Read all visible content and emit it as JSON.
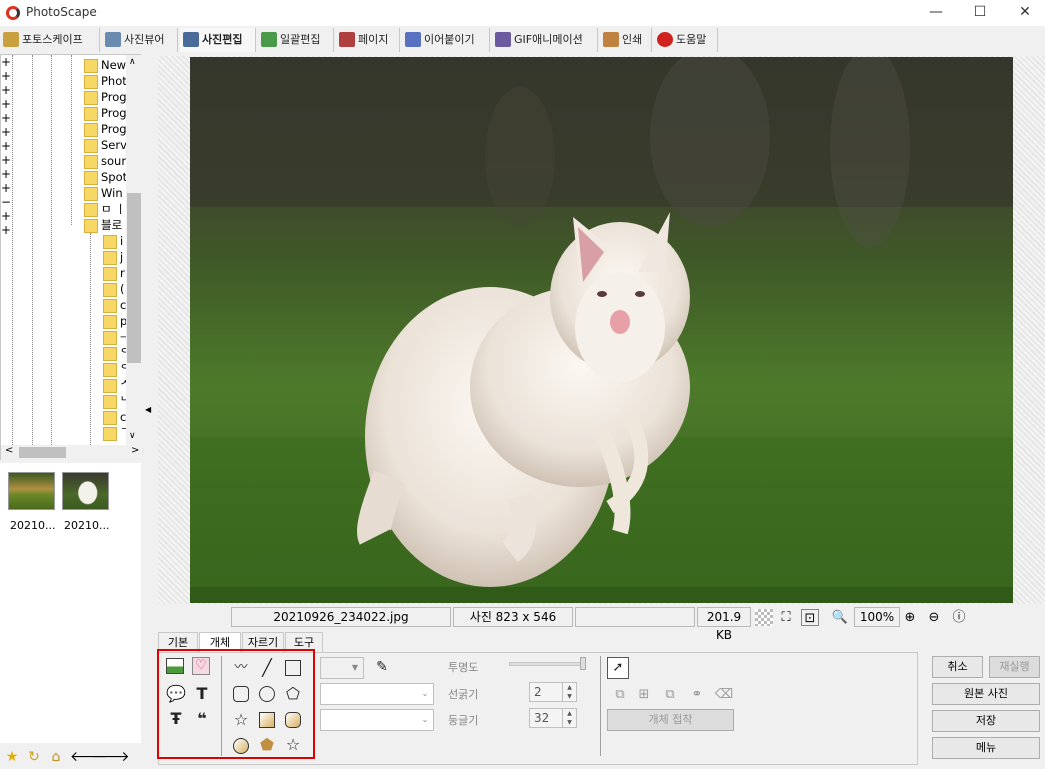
{
  "window": {
    "title": "PhotoScape",
    "minimize": "—",
    "maximize": "☐",
    "close": "✕"
  },
  "tabs": [
    {
      "label": "포토스케이프",
      "icon": "photoscape-books-icon",
      "color": "#c8a040"
    },
    {
      "label": "사진뷰어",
      "icon": "viewer-books-icon",
      "color": "#6a8ab0"
    },
    {
      "label": "사진편집",
      "icon": "editor-books-icon",
      "color": "#4a6a9a"
    },
    {
      "label": "일괄편집",
      "icon": "batch-books-icon",
      "color": "#4a9a4a"
    },
    {
      "label": "페이지",
      "icon": "page-books-icon",
      "color": "#b04040"
    },
    {
      "label": "이어붙이기",
      "icon": "combine-books-icon",
      "color": "#5a70c0"
    },
    {
      "label": "GIF애니메이션",
      "icon": "gif-books-icon",
      "color": "#6a5aa0"
    },
    {
      "label": "인쇄",
      "icon": "print-books-icon",
      "color": "#c08040"
    },
    {
      "label": "도움말",
      "icon": "help-icon",
      "color": "#d02020"
    }
  ],
  "tree": {
    "items": [
      "New",
      "Phot",
      "Prog",
      "Prog",
      "Prog",
      "Serv",
      "sour",
      "Spot",
      "Win",
      "ㅁ ㅣ",
      "블로",
      "i",
      "j",
      "r",
      "(",
      "c",
      "p",
      "ᅳ",
      "ᄋ",
      "ᄋ",
      "ᄉ",
      "ᄂ",
      "c",
      "ᄀ"
    ]
  },
  "thumbnails": [
    {
      "label": "20210...",
      "kind": "landscape"
    },
    {
      "label": "20210...",
      "kind": "wallaby"
    }
  ],
  "status": {
    "filename": "20210926_234022.jpg",
    "dimensions": "사진 823 x 546",
    "empty": "",
    "filesize": "201.9 KB",
    "zoom": "100%"
  },
  "subtabs": [
    "기본",
    "개체",
    "자르기",
    "도구"
  ],
  "active_subtab": "개체",
  "object_panel": {
    "opacity_label": "투명도",
    "line_width_label": "선굵기",
    "line_width_value": "2",
    "roundness_label": "둥글기",
    "roundness_value": "32",
    "attach_button": "개체 접착"
  },
  "buttons": {
    "undo": "취소",
    "redo": "재실행",
    "original": "원본 사진",
    "save": "저장",
    "menu": "메뉴"
  }
}
